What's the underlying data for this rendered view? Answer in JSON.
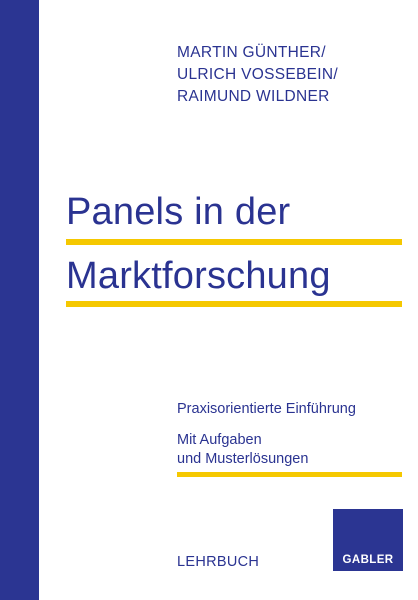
{
  "cover": {
    "authors": [
      "MARTIN GÜNTHER/",
      "ULRICH VOSSEBEIN/",
      "RAIMUND WILDNER"
    ],
    "title_lines": [
      "Panels in der",
      "Marktforschung"
    ],
    "subtitle": "Praxisorientierte Einführung",
    "note_lines": [
      "Mit Aufgaben",
      "und Musterlösungen"
    ],
    "series": "LEHRBUCH",
    "publisher_logo": "GABLER",
    "colors": {
      "spine": "#2b3592",
      "accent": "#f5c800",
      "text": "#2a3391",
      "background": "#ffffff"
    }
  }
}
